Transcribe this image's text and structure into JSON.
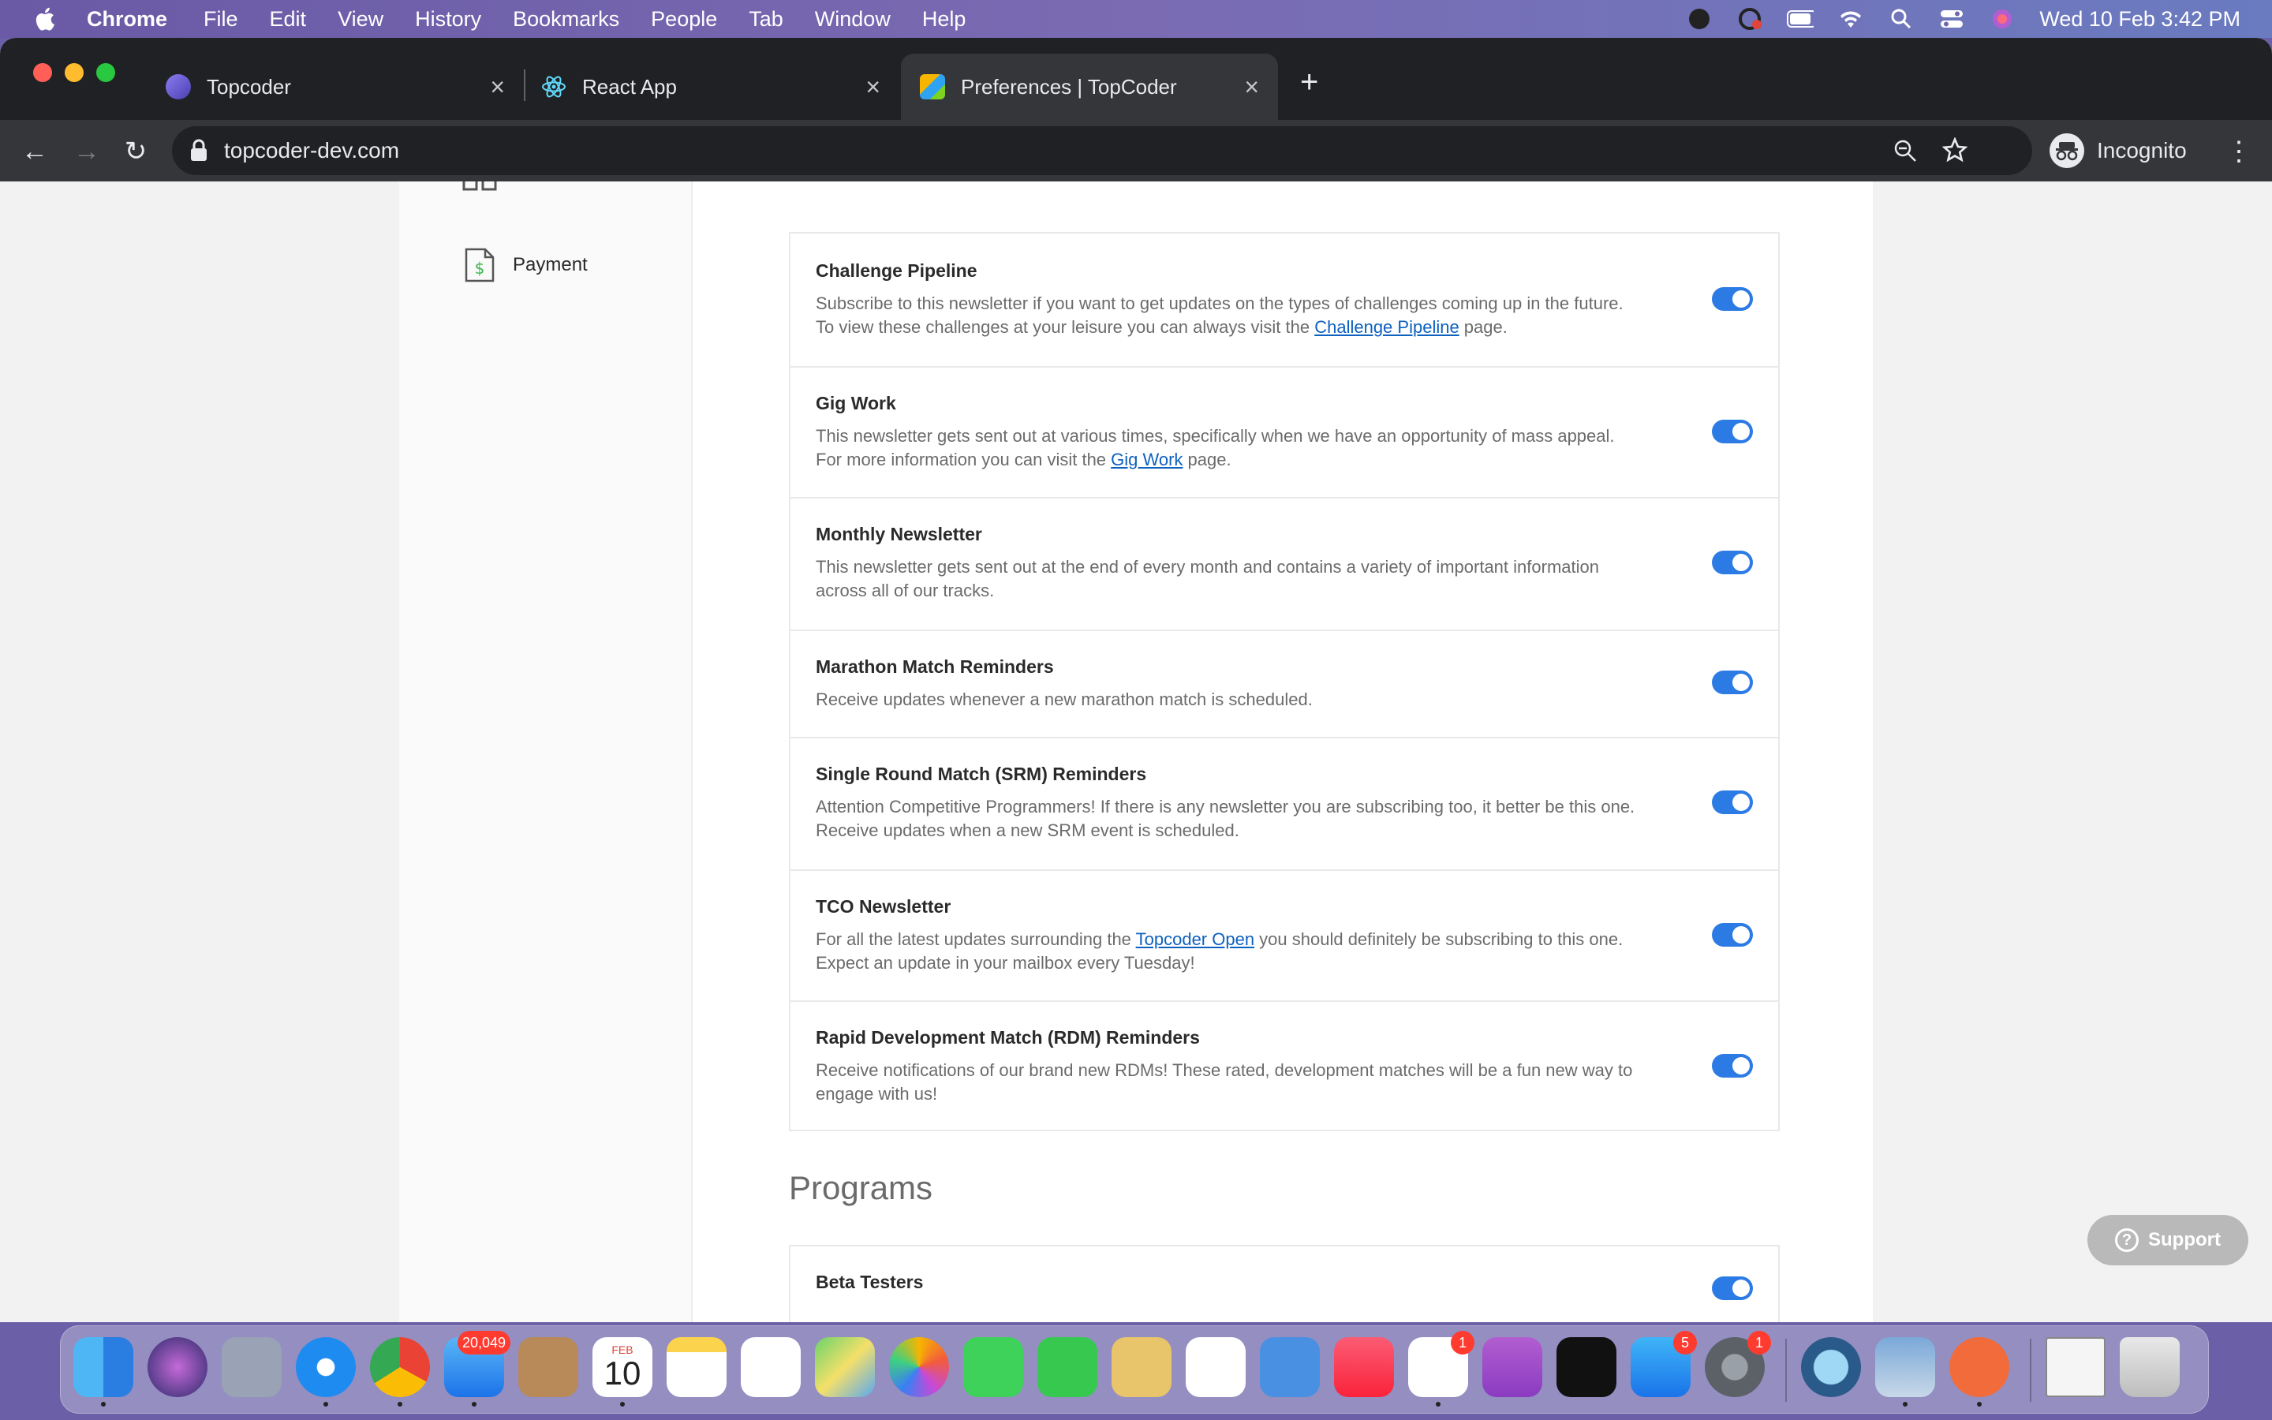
{
  "menubar": {
    "app": "Chrome",
    "items": [
      "File",
      "Edit",
      "View",
      "History",
      "Bookmarks",
      "People",
      "Tab",
      "Window",
      "Help"
    ],
    "clock": "Wed 10 Feb  3:42 PM"
  },
  "tabs": [
    {
      "label": "Topcoder"
    },
    {
      "label": "React App"
    },
    {
      "label": "Preferences | TopCoder"
    }
  ],
  "address": "topcoder-dev.com",
  "profile": "Incognito",
  "sidebar": {
    "payment": "Payment"
  },
  "newsletters": [
    {
      "title": "Challenge Pipeline",
      "line1": "Subscribe to this newsletter if you want to get updates on the types of challenges coming up in the future.",
      "line2_pre": "To view these challenges at your leisure you can always visit the ",
      "link": "Challenge Pipeline",
      "line2_post": " page.",
      "enabled": true
    },
    {
      "title": "Gig Work",
      "line1": "This newsletter gets sent out at various times, specifically when we have an opportunity of mass appeal.",
      "line2_pre": "For more information you can visit the ",
      "link": "Gig Work",
      "line2_post": " page.",
      "enabled": true
    },
    {
      "title": "Monthly Newsletter",
      "line1": "This newsletter gets sent out at the end of every month and contains a variety of important information",
      "line2_pre": "across all of our tracks.",
      "link": "",
      "line2_post": "",
      "enabled": true
    },
    {
      "title": "Marathon Match Reminders",
      "line1": "Receive updates whenever a new marathon match is scheduled.",
      "line2_pre": "",
      "link": "",
      "line2_post": "",
      "enabled": true
    },
    {
      "title": "Single Round Match (SRM) Reminders",
      "line1": "Attention Competitive Programmers! If there is any newsletter you are subscribing too, it better be this one.",
      "line2_pre": "Receive updates when a new SRM event is scheduled.",
      "link": "",
      "line2_post": "",
      "enabled": true
    },
    {
      "title": "TCO Newsletter",
      "line1_pre": "For all the latest updates surrounding the ",
      "link": "Topcoder Open",
      "line1_post": " you should definitely be subscribing to this one.",
      "line2_pre": "Expect an update in your mailbox every Tuesday!",
      "enabled": true
    },
    {
      "title": "Rapid Development Match (RDM) Reminders",
      "line1": "Receive notifications of our brand new RDMs! These rated, development matches will be a fun new way to",
      "line2_pre": "engage with us!",
      "link": "",
      "line2_post": "",
      "enabled": true
    }
  ],
  "programs": {
    "heading": "Programs",
    "items": [
      {
        "title": "Beta Testers",
        "enabled": true
      }
    ]
  },
  "support": "Support",
  "dock": {
    "mail_badge": "20,049",
    "calendar_month": "FEB",
    "calendar_day": "10",
    "slack_badge": "1",
    "appstore_badge": "5",
    "settings_badge": "1"
  }
}
